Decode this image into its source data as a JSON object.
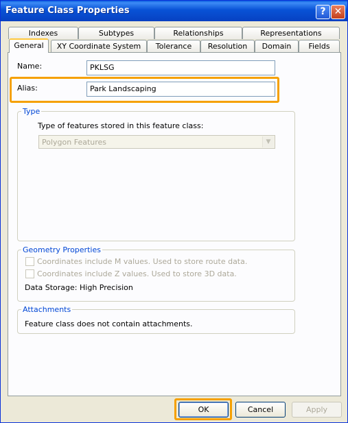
{
  "window": {
    "title": "Feature Class Properties",
    "help_glyph": "?",
    "close_glyph": "✕"
  },
  "tabs_row1": [
    "Indexes",
    "Subtypes",
    "Relationships",
    "Representations"
  ],
  "tabs_row2": [
    "General",
    "XY Coordinate System",
    "Tolerance",
    "Resolution",
    "Domain",
    "Fields"
  ],
  "active_tab": "General",
  "general": {
    "name_label": "Name:",
    "name_value": "PKLSG",
    "alias_label": "Alias:",
    "alias_value": "Park Landscaping",
    "type_group": {
      "legend": "Type",
      "description": "Type of features stored in this feature class:",
      "selected": "Polygon Features"
    },
    "geometry_group": {
      "legend": "Geometry Properties",
      "m_values": "Coordinates include M values. Used to store route data.",
      "z_values": "Coordinates include Z values. Used to store 3D data.",
      "storage": "Data Storage: High Precision"
    },
    "attachments_group": {
      "legend": "Attachments",
      "text": "Feature class does not contain attachments."
    }
  },
  "buttons": {
    "ok": "OK",
    "cancel": "Cancel",
    "apply": "Apply"
  },
  "colors": {
    "highlight": "#f5a000",
    "titlebar": "#0852d6",
    "group_legend": "#0046d5"
  }
}
